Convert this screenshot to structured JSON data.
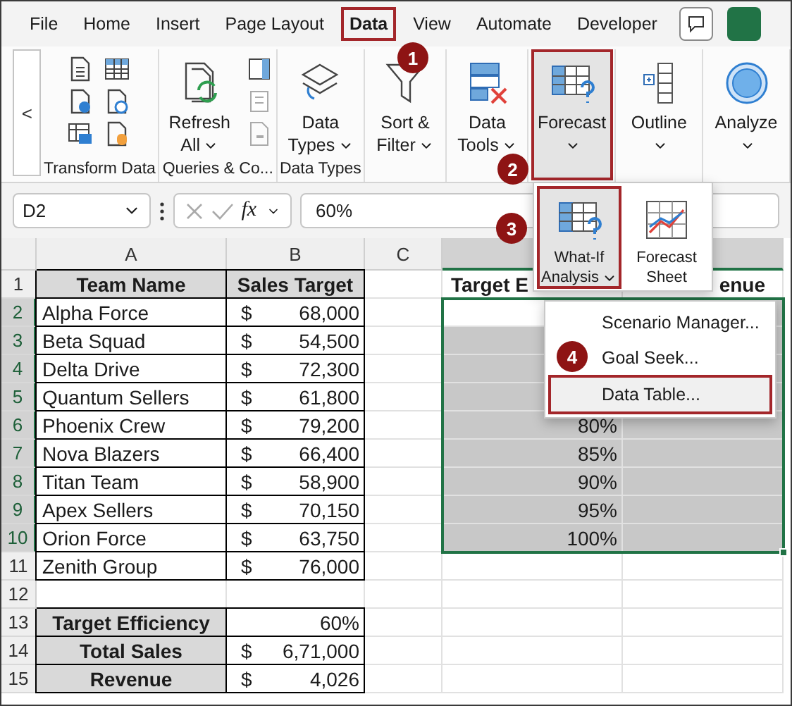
{
  "menu_tabs": [
    {
      "label": "File",
      "selected": false,
      "outlined": false
    },
    {
      "label": "Home",
      "selected": false,
      "outlined": false
    },
    {
      "label": "Insert",
      "selected": false,
      "outlined": false
    },
    {
      "label": "Page Layout",
      "selected": false,
      "outlined": false
    },
    {
      "label": "Data",
      "selected": true,
      "outlined": true,
      "step": "1"
    },
    {
      "label": "View",
      "selected": false,
      "outlined": false
    },
    {
      "label": "Automate",
      "selected": false,
      "outlined": false
    },
    {
      "label": "Developer",
      "selected": false,
      "outlined": false
    }
  ],
  "ribbon": {
    "scroll_button": "<",
    "groups": [
      {
        "kind": "icons",
        "label": "Transform Data"
      },
      {
        "kind": "queries",
        "label": "Queries & Co...",
        "buttons": [
          {
            "kind": "refresh",
            "label": "Refresh All",
            "caret": true,
            "selected": false,
            "outlined": false
          }
        ]
      },
      {
        "kind": "single",
        "label": "Data Types",
        "buttons": [
          {
            "kind": "layers",
            "label": "Data Types",
            "caret": true,
            "selected": false,
            "outlined": false
          }
        ]
      },
      {
        "kind": "single",
        "buttons": [
          {
            "kind": "funnel",
            "label": "Sort & Filter",
            "caret": true,
            "selected": false,
            "outlined": false
          }
        ]
      },
      {
        "kind": "single",
        "buttons": [
          {
            "kind": "datatools",
            "label": "Data Tools",
            "caret": true,
            "selected": false,
            "outlined": false
          }
        ]
      },
      {
        "kind": "single",
        "buttons": [
          {
            "kind": "grid",
            "label": "Forecast",
            "caret": true,
            "selected": true,
            "outlined": true,
            "step": "2"
          }
        ]
      },
      {
        "kind": "single",
        "buttons": [
          {
            "kind": "outline",
            "label": "Outline",
            "caret": true,
            "selected": false,
            "outlined": false
          }
        ]
      },
      {
        "kind": "single",
        "buttons": [
          {
            "kind": "circle",
            "label": "Analyze",
            "caret": true,
            "selected": false,
            "outlined": false
          }
        ]
      }
    ]
  },
  "formula_bar": {
    "name_box": "D2",
    "function_label": "fx",
    "value": "60%"
  },
  "columns": [
    {
      "label": "A",
      "selected": false
    },
    {
      "label": "B",
      "selected": false
    },
    {
      "label": "C",
      "selected": false
    },
    {
      "selected": true
    },
    {
      "selected": true
    }
  ],
  "rows": [
    {
      "number": "1",
      "selected": false,
      "cells": [
        {
          "kind": "header",
          "text": "Team Name"
        },
        {
          "kind": "header",
          "text": "Sales Target"
        },
        {
          "kind": "blank"
        },
        {
          "kind": "header_start",
          "text": "Target E"
        },
        {
          "kind": "header_end",
          "text": "enue"
        }
      ]
    },
    {
      "number": "2",
      "selected": true,
      "cells": [
        {
          "kind": "text",
          "text": "Alpha Force"
        },
        {
          "kind": "currency",
          "symbol": "$",
          "text": "68,000"
        },
        {
          "kind": "blank"
        },
        {
          "kind": "blank",
          "shaded": false
        },
        {
          "kind": "blank",
          "shaded": true
        }
      ]
    },
    {
      "number": "3",
      "selected": true,
      "cells": [
        {
          "kind": "text",
          "text": "Beta Squad"
        },
        {
          "kind": "currency",
          "symbol": "$",
          "text": "54,500"
        },
        {
          "kind": "blank"
        },
        {
          "kind": "blank",
          "shaded": true
        },
        {
          "kind": "blank",
          "shaded": true
        }
      ]
    },
    {
      "number": "4",
      "selected": true,
      "cells": [
        {
          "kind": "text",
          "text": "Delta Drive"
        },
        {
          "kind": "currency",
          "symbol": "$",
          "text": "72,300"
        },
        {
          "kind": "blank"
        },
        {
          "kind": "blank",
          "shaded": true
        },
        {
          "kind": "blank",
          "shaded": true
        }
      ]
    },
    {
      "number": "5",
      "selected": true,
      "cells": [
        {
          "kind": "text",
          "text": "Quantum Sellers"
        },
        {
          "kind": "currency",
          "symbol": "$",
          "text": "61,800"
        },
        {
          "kind": "blank"
        },
        {
          "kind": "blank",
          "shaded": true
        },
        {
          "kind": "blank",
          "shaded": true
        }
      ]
    },
    {
      "number": "6",
      "selected": true,
      "cells": [
        {
          "kind": "text",
          "text": "Phoenix Crew"
        },
        {
          "kind": "currency",
          "symbol": "$",
          "text": "79,200"
        },
        {
          "kind": "blank"
        },
        {
          "kind": "number",
          "text": "80%",
          "shaded": true
        },
        {
          "kind": "blank",
          "shaded": true
        }
      ]
    },
    {
      "number": "7",
      "selected": true,
      "cells": [
        {
          "kind": "text",
          "text": "Nova Blazers"
        },
        {
          "kind": "currency",
          "symbol": "$",
          "text": "66,400"
        },
        {
          "kind": "blank"
        },
        {
          "kind": "number",
          "text": "85%",
          "shaded": true
        },
        {
          "kind": "blank",
          "shaded": true
        }
      ]
    },
    {
      "number": "8",
      "selected": true,
      "cells": [
        {
          "kind": "text",
          "text": "Titan Team"
        },
        {
          "kind": "currency",
          "symbol": "$",
          "text": "58,900"
        },
        {
          "kind": "blank"
        },
        {
          "kind": "number",
          "text": "90%",
          "shaded": true
        },
        {
          "kind": "blank",
          "shaded": true
        }
      ]
    },
    {
      "number": "9",
      "selected": true,
      "cells": [
        {
          "kind": "text",
          "text": "Apex Sellers"
        },
        {
          "kind": "currency",
          "symbol": "$",
          "text": "70,150"
        },
        {
          "kind": "blank"
        },
        {
          "kind": "number",
          "text": "95%",
          "shaded": true
        },
        {
          "kind": "blank",
          "shaded": true
        }
      ]
    },
    {
      "number": "10",
      "selected": true,
      "cells": [
        {
          "kind": "text",
          "text": "Orion Force"
        },
        {
          "kind": "currency",
          "symbol": "$",
          "text": "63,750"
        },
        {
          "kind": "blank"
        },
        {
          "kind": "number",
          "text": "100%",
          "shaded": true
        },
        {
          "kind": "blank",
          "shaded": true
        }
      ]
    },
    {
      "number": "11",
      "selected": false,
      "cells": [
        {
          "kind": "text",
          "text": "Zenith Group"
        },
        {
          "kind": "currency",
          "symbol": "$",
          "text": "76,000"
        },
        {
          "kind": "blank"
        },
        {
          "kind": "blank"
        },
        {
          "kind": "blank"
        }
      ]
    },
    {
      "number": "12",
      "selected": false,
      "cells": [
        {
          "kind": "blank"
        },
        {
          "kind": "blank"
        },
        {
          "kind": "blank"
        },
        {
          "kind": "blank"
        },
        {
          "kind": "blank"
        }
      ]
    },
    {
      "number": "13",
      "selected": false,
      "cells": [
        {
          "kind": "header",
          "text": "Target Efficiency"
        },
        {
          "kind": "number",
          "text": "60%"
        },
        {
          "kind": "blank"
        },
        {
          "kind": "blank"
        },
        {
          "kind": "blank"
        }
      ]
    },
    {
      "number": "14",
      "selected": false,
      "cells": [
        {
          "kind": "header",
          "text": "Total Sales"
        },
        {
          "kind": "currency",
          "symbol": "$",
          "text": "6,71,000"
        },
        {
          "kind": "blank"
        },
        {
          "kind": "blank"
        },
        {
          "kind": "blank"
        }
      ]
    },
    {
      "number": "15",
      "selected": false,
      "cells": [
        {
          "kind": "header",
          "text": "Revenue"
        },
        {
          "kind": "currency",
          "symbol": "$",
          "text": "4,026"
        },
        {
          "kind": "blank"
        },
        {
          "kind": "blank"
        },
        {
          "kind": "blank"
        }
      ]
    }
  ],
  "forecast_menu": {
    "buttons": [
      {
        "kind": "grid",
        "label": "What-If Analysis",
        "caret": true,
        "selected": true,
        "outlined": true,
        "step": "3"
      },
      {
        "kind": "chart",
        "label": "Forecast Sheet",
        "caret": false,
        "selected": false,
        "outlined": false
      }
    ]
  },
  "what_if_menu": {
    "items": [
      {
        "label": "Scenario Manager...",
        "selected": false,
        "outlined": false
      },
      {
        "label": "Goal Seek...",
        "selected": false,
        "outlined": false,
        "step": "4"
      },
      {
        "label": "Data Table...",
        "selected": true,
        "outlined": true
      }
    ]
  }
}
